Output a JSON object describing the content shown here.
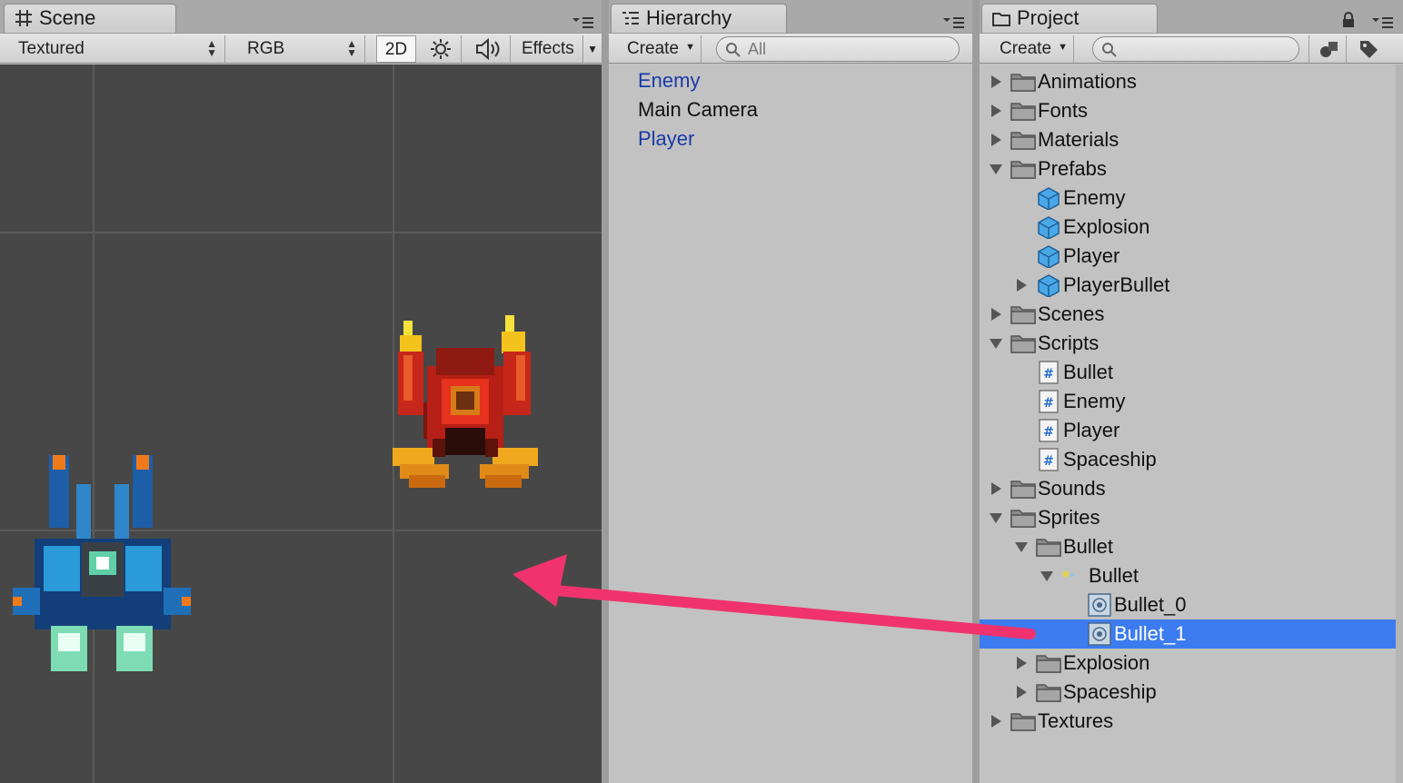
{
  "scene": {
    "tab_title": "Scene",
    "shading_mode": "Textured",
    "render_mode": "RGB",
    "mode_2d": "2D",
    "effects": "Effects"
  },
  "hierarchy": {
    "tab_title": "Hierarchy",
    "create_label": "Create",
    "search_placeholder": "All",
    "items": [
      {
        "label": "Enemy",
        "prefab": true
      },
      {
        "label": "Main Camera",
        "prefab": false
      },
      {
        "label": "Player",
        "prefab": true
      }
    ]
  },
  "project": {
    "tab_title": "Project",
    "create_label": "Create",
    "search_placeholder": "",
    "tree": [
      {
        "label": "Animations",
        "icon": "folder-icon",
        "expanded": false
      },
      {
        "label": "Fonts",
        "icon": "folder-icon",
        "expanded": false
      },
      {
        "label": "Materials",
        "icon": "folder-icon",
        "expanded": false
      },
      {
        "label": "Prefabs",
        "icon": "folder-icon",
        "expanded": true
      },
      {
        "label": "Enemy",
        "icon": "prefab-cube-icon"
      },
      {
        "label": "Explosion",
        "icon": "prefab-cube-icon"
      },
      {
        "label": "Player",
        "icon": "prefab-cube-icon"
      },
      {
        "label": "PlayerBullet",
        "icon": "prefab-cube-icon",
        "expanded": false
      },
      {
        "label": "Scenes",
        "icon": "folder-icon",
        "expanded": false
      },
      {
        "label": "Scripts",
        "icon": "folder-icon",
        "expanded": true
      },
      {
        "label": "Bullet",
        "icon": "csharp-script-icon"
      },
      {
        "label": "Enemy",
        "icon": "csharp-script-icon"
      },
      {
        "label": "Player",
        "icon": "csharp-script-icon"
      },
      {
        "label": "Spaceship",
        "icon": "csharp-script-icon"
      },
      {
        "label": "Sounds",
        "icon": "folder-icon",
        "expanded": false
      },
      {
        "label": "Sprites",
        "icon": "folder-icon",
        "expanded": true
      },
      {
        "label": "Bullet",
        "icon": "folder-icon",
        "expanded": true
      },
      {
        "label": "Bullet",
        "icon": "texture-icon",
        "expanded": true
      },
      {
        "label": "Bullet_0",
        "icon": "sprite-icon"
      },
      {
        "label": "Bullet_1",
        "icon": "sprite-icon",
        "selected": true
      },
      {
        "label": "Explosion",
        "icon": "folder-icon",
        "expanded": false
      },
      {
        "label": "Spaceship",
        "icon": "folder-icon",
        "expanded": false
      },
      {
        "label": "Textures",
        "icon": "folder-icon",
        "expanded": false
      }
    ]
  },
  "colors": {
    "selection": "#3d7cf0",
    "prefab_text": "#1a3aa8",
    "scene_background": "#474747",
    "drag_arrow": "#f0336e"
  }
}
